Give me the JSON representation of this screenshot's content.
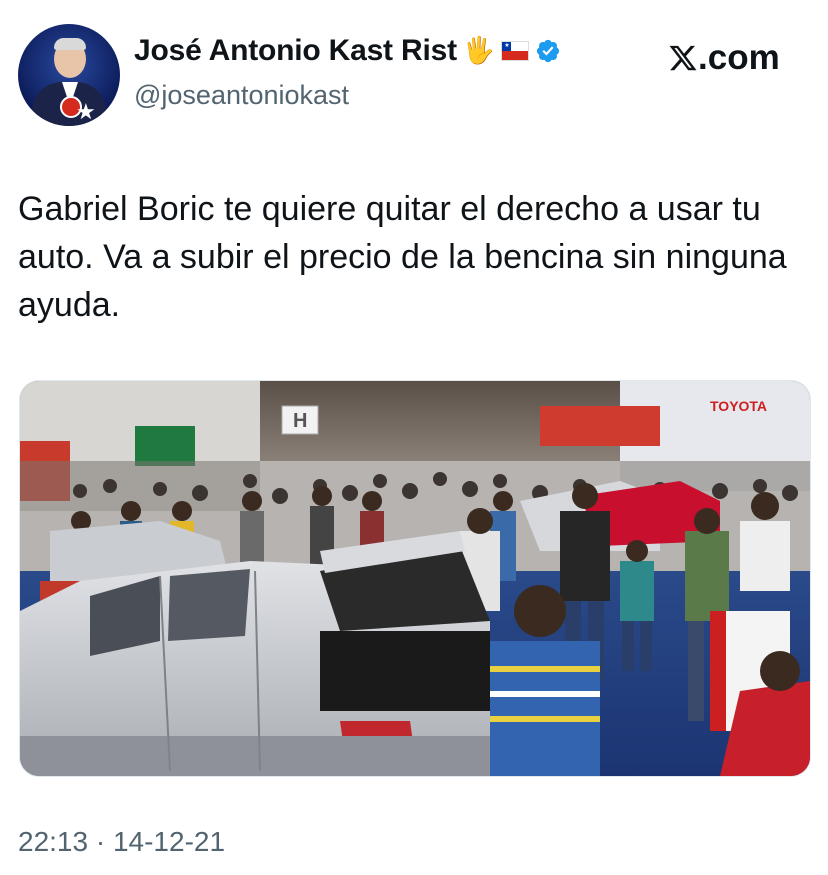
{
  "author": {
    "name": "José Antonio Kast Rist",
    "handle": "@joseantoniokast",
    "emoji_hand": "🖐",
    "verified_color": "#1d9bf0"
  },
  "brand": {
    "logo_text": ".com"
  },
  "tweet": {
    "text": "Gabriel Boric te quiere quitar el derecho a usar tu auto. Va a subir el precio de la bencina sin ninguna ayuda."
  },
  "media": {
    "signs": {
      "honda": "H",
      "toyota": "TOYOTA"
    }
  },
  "timestamp": "22:13 · 14-12-21"
}
